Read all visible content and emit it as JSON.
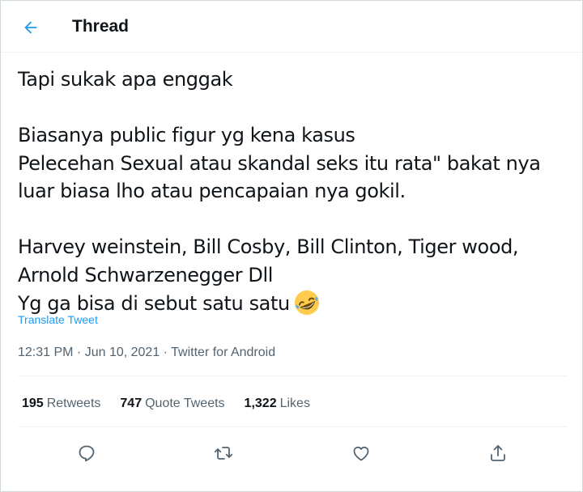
{
  "header": {
    "back_icon": "arrow-left-icon",
    "title": "Thread"
  },
  "tweet": {
    "text": "Tapi sukak apa enggak\n\nBiasanya public figur yg kena kasus\nPelecehan Sexual atau skandal seks itu rata\" bakat nya\nluar biasa lho atau pencapaian nya gokil.\n\nHarvey weinstein, Bill Cosby, Bill Clinton, Tiger wood,\nArnold Schwarzenegger Dll\nYg ga bisa di sebut satu satu",
    "emoji": "rolling-on-the-floor-laughing-emoji",
    "translate_label": "Translate Tweet",
    "meta": "12:31 PM · Jun 10, 2021 · Twitter for Android"
  },
  "stats": {
    "retweets": {
      "count": "195",
      "label": "Retweets"
    },
    "quotes": {
      "count": "747",
      "label": "Quote Tweets"
    },
    "likes": {
      "count": "1,322",
      "label": "Likes"
    }
  },
  "actions": [
    "reply-icon",
    "retweet-icon",
    "like-icon",
    "share-icon"
  ],
  "colors": {
    "accent": "#1d9bf0",
    "text": "#0f1419",
    "secondary": "#536471",
    "border": "#eff3f4"
  }
}
